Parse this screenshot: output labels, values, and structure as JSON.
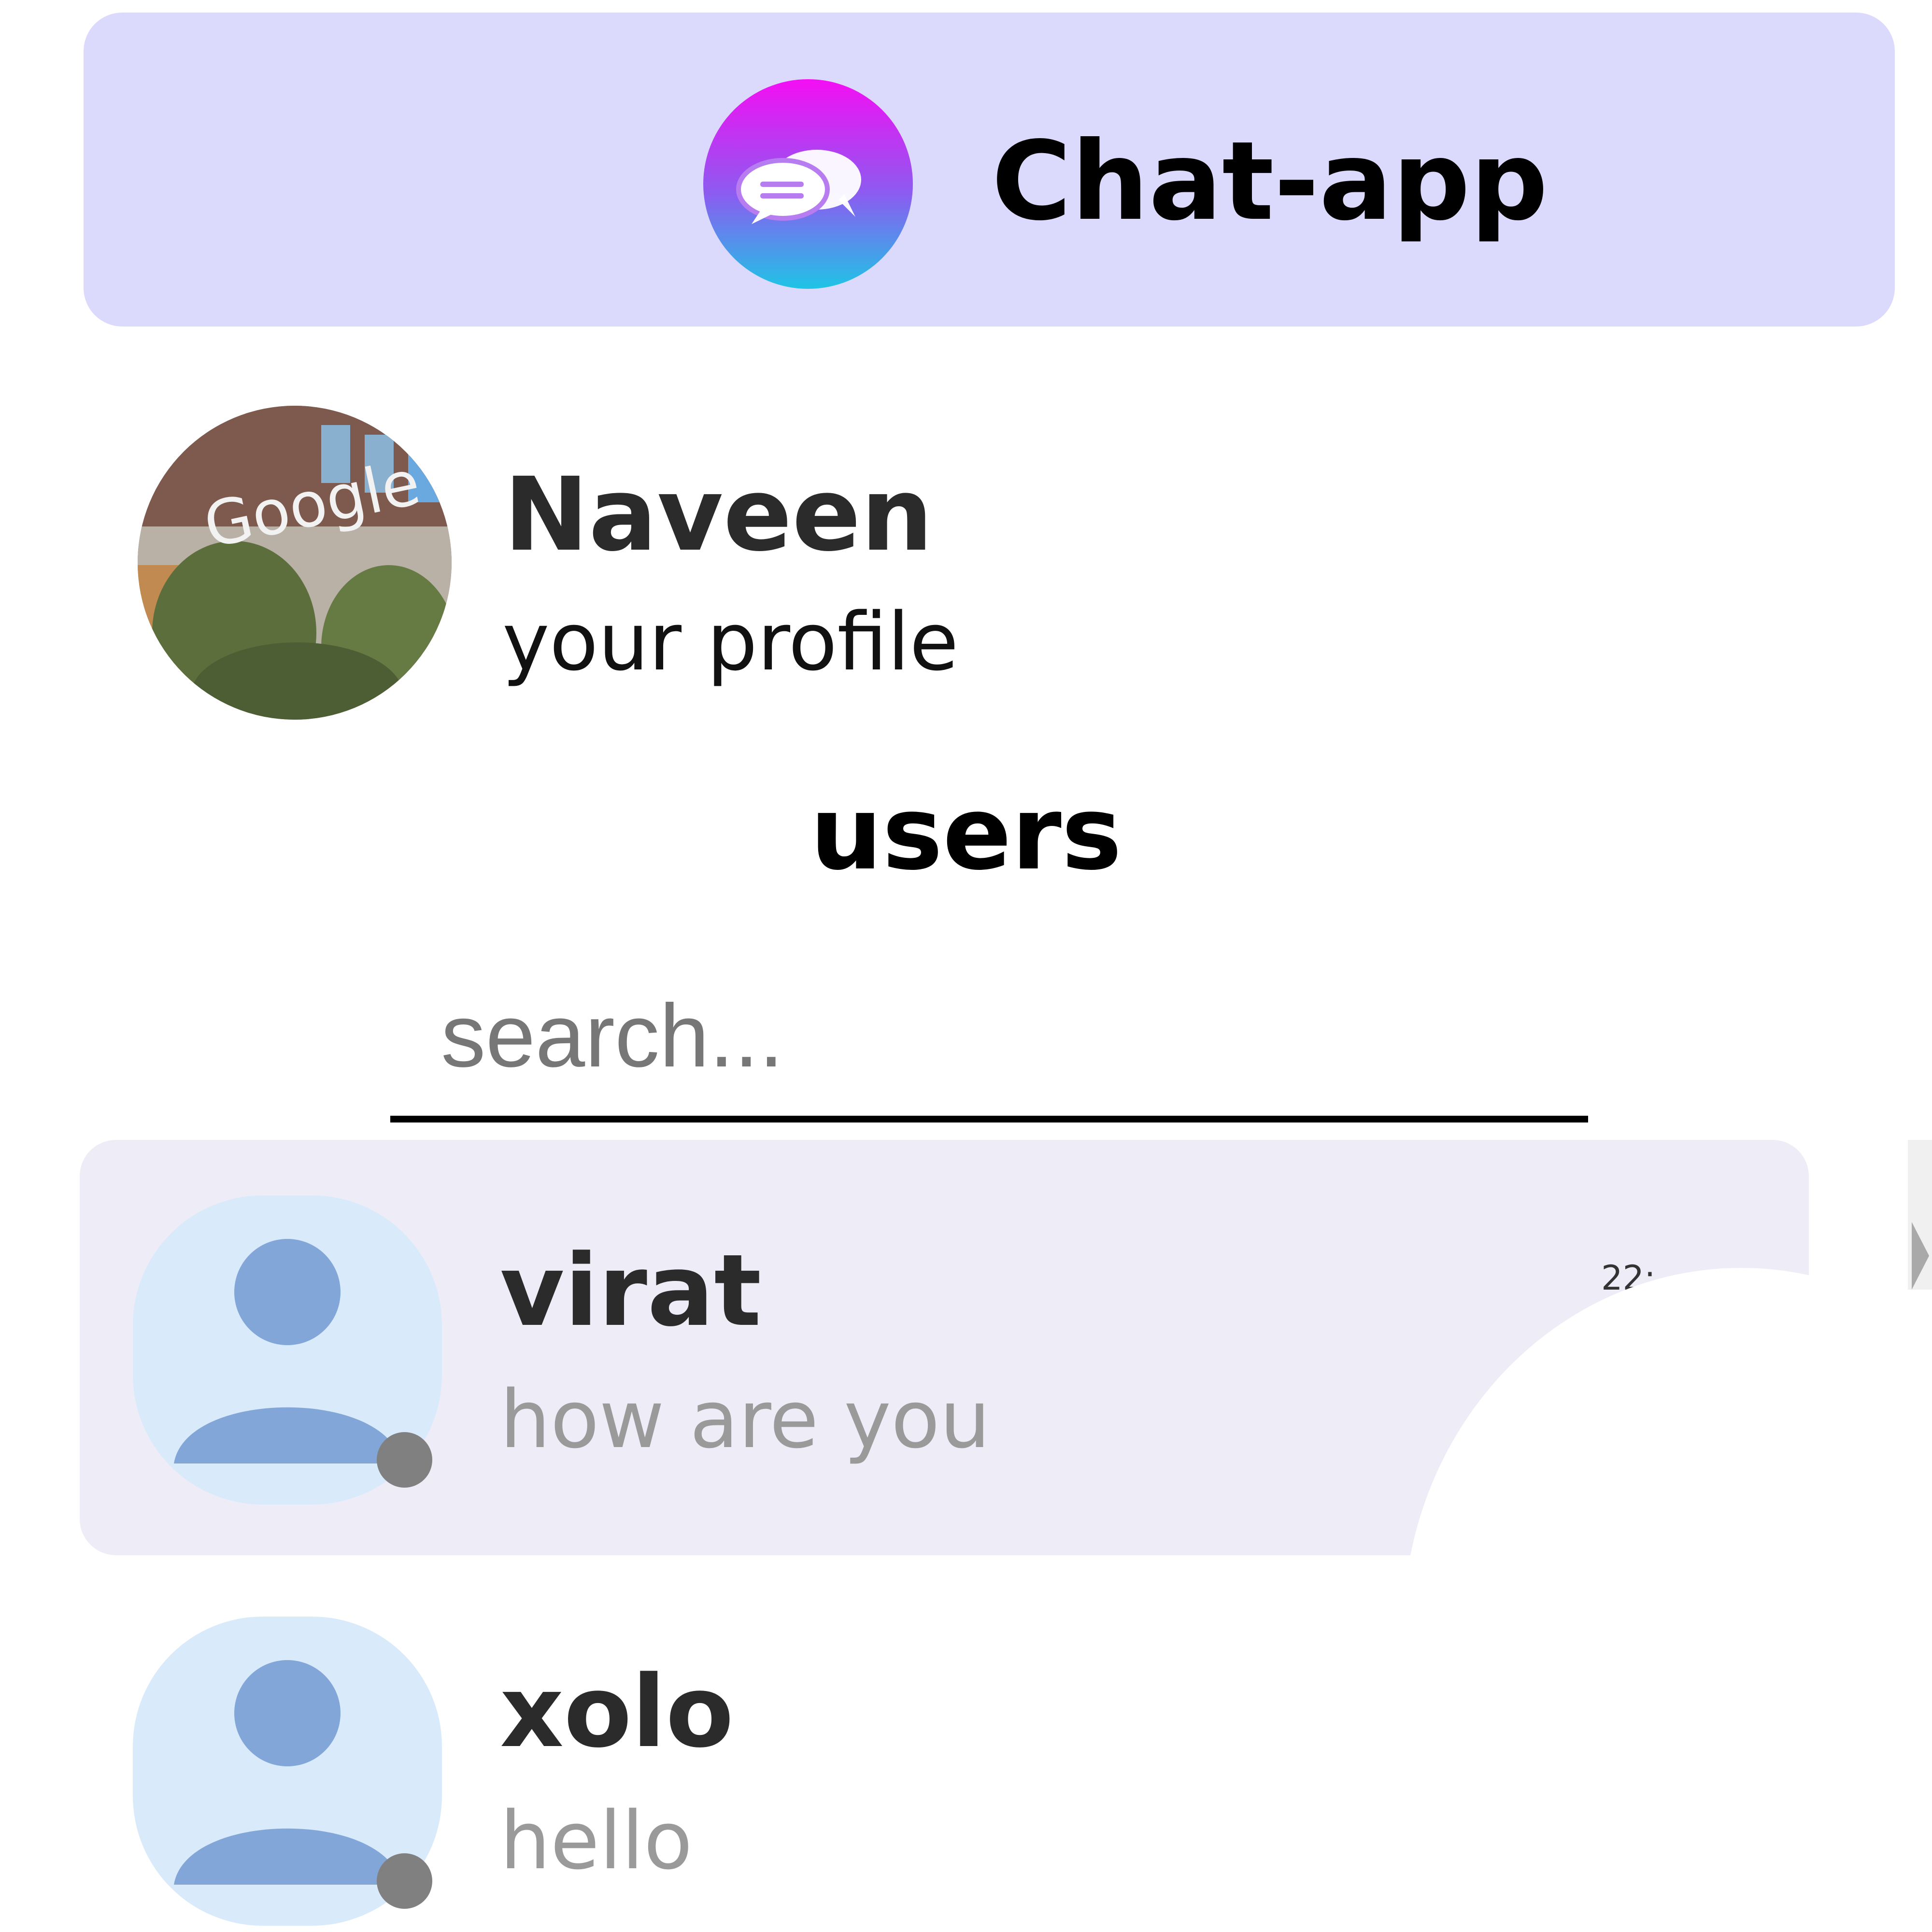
{
  "header": {
    "app_title": "Chat-app",
    "logo_icon": "chat-bubbles-icon",
    "logo_gradient": [
      "#f40ef4",
      "#8b5cf0",
      "#1fc4e6"
    ],
    "background": "#dcdafc"
  },
  "profile": {
    "name": "Naveen",
    "subtitle": "your profile",
    "avatar": "profile-photo"
  },
  "users_heading": "users",
  "search": {
    "placeholder": "search...",
    "value": ""
  },
  "users": [
    {
      "name": "virat",
      "last_message": "how are you",
      "time": "22:",
      "status": "offline",
      "status_color": "#808080",
      "active": true
    },
    {
      "name": "xolo",
      "last_message": "hello",
      "time": "",
      "status": "offline",
      "status_color": "#808080",
      "active": false
    }
  ],
  "colors": {
    "active_row": "#eeedf7",
    "avatar_bg": "#d9eafb",
    "avatar_fg": "#82a6d8"
  }
}
